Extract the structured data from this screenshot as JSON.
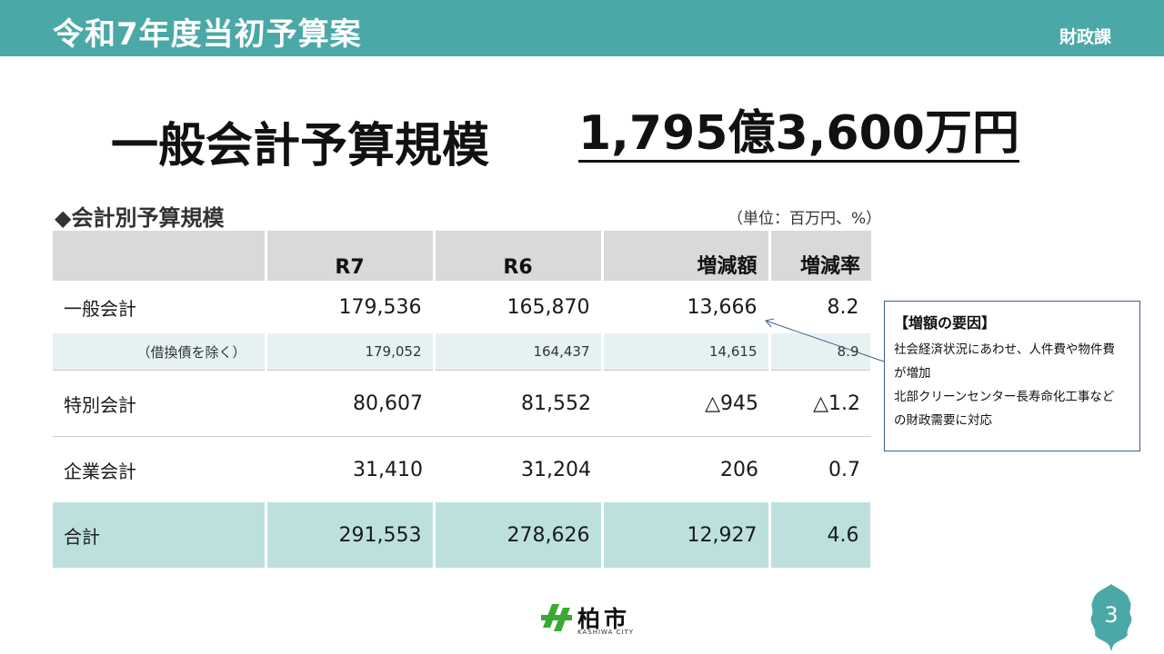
{
  "header": {
    "title": "令和7年度当初予算案",
    "department": "財政課"
  },
  "headline": {
    "label": "一般会計予算規模",
    "amount": "1,795億3,600万円"
  },
  "section": {
    "title": "◆会計別予算規模",
    "unit": "（単位：百万円、%）"
  },
  "table": {
    "columns": [
      "",
      "R7",
      "R6",
      "増減額",
      "増減率"
    ],
    "rows": [
      {
        "label": "一般会計",
        "r7": "179,536",
        "r6": "165,870",
        "diff": "13,666",
        "rate": "8.2"
      },
      {
        "label": "（借換債を除く）",
        "r7": "179,052",
        "r6": "164,437",
        "diff": "14,615",
        "rate": "8.9"
      },
      {
        "label": "特別会計",
        "r7": "80,607",
        "r6": "81,552",
        "diff": "△945",
        "rate": "△1.2"
      },
      {
        "label": "企業会計",
        "r7": "31,410",
        "r6": "31,204",
        "diff": "206",
        "rate": "0.7"
      },
      {
        "label": "合計",
        "r7": "291,553",
        "r6": "278,626",
        "diff": "12,927",
        "rate": "4.6"
      }
    ]
  },
  "note": {
    "title": "【増額の要因】",
    "lines": [
      "社会経済状況にあわせ、人件費や物件費",
      "が増加",
      "北部クリーンセンター長寿命化工事など",
      "の財政需要に対応"
    ]
  },
  "logo": {
    "name": "柏市",
    "sub": "KASHIWA CITY"
  },
  "page_number": "3",
  "colors": {
    "header": "#4aa9a7",
    "table_header": "#d9d9d9",
    "sub_row": "#e6f2f2",
    "total_row": "#bde0de",
    "note_border": "#3f5f8f",
    "logo_green": "#3aaa35"
  }
}
